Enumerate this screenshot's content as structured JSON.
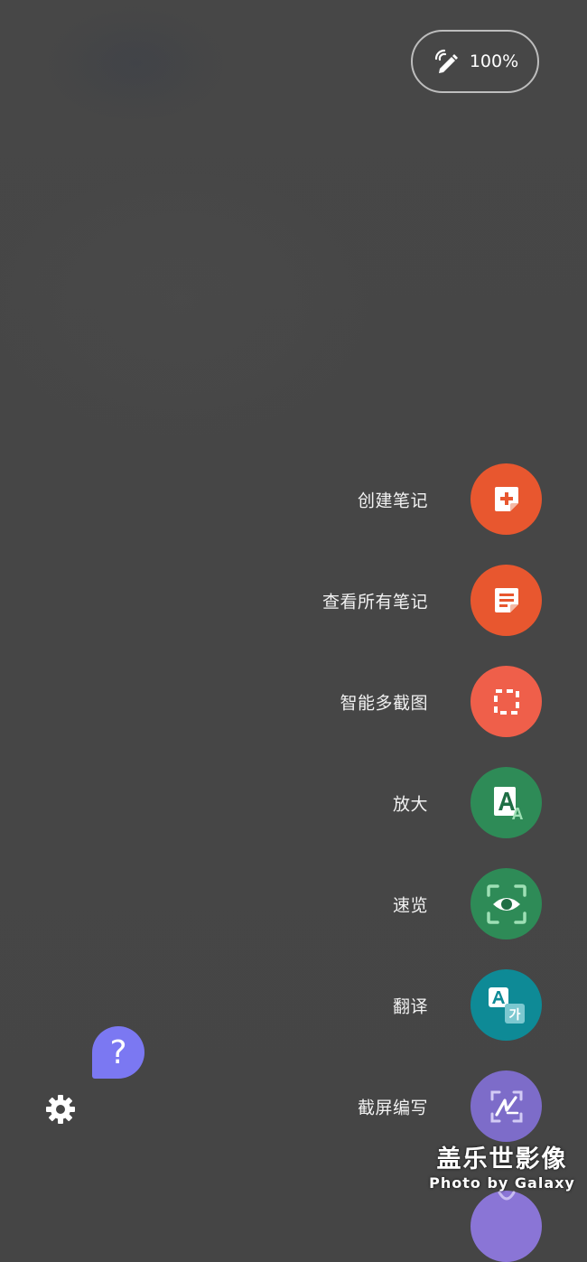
{
  "status": {
    "battery": "100%",
    "pen_icon": "pen-signal-icon"
  },
  "menu": {
    "items": [
      {
        "label": "创建笔记",
        "icon": "create-note-icon",
        "color": "#e8572f"
      },
      {
        "label": "查看所有笔记",
        "icon": "view-notes-icon",
        "color": "#e8572f"
      },
      {
        "label": "智能多截图",
        "icon": "smart-select-icon",
        "color": "#ef5f4a"
      },
      {
        "label": "放大",
        "icon": "magnify-icon",
        "color": "#2e8b57"
      },
      {
        "label": "速览",
        "icon": "glance-icon",
        "color": "#2e8b57"
      },
      {
        "label": "翻译",
        "icon": "translate-icon",
        "color": "#0e8a96"
      },
      {
        "label": "截屏编写",
        "icon": "screen-write-icon",
        "color": "#7d6cc9"
      }
    ]
  },
  "help": {
    "symbol": "?"
  },
  "watermark": {
    "main": "盖乐世影像",
    "sub": "Photo by Galaxy"
  }
}
